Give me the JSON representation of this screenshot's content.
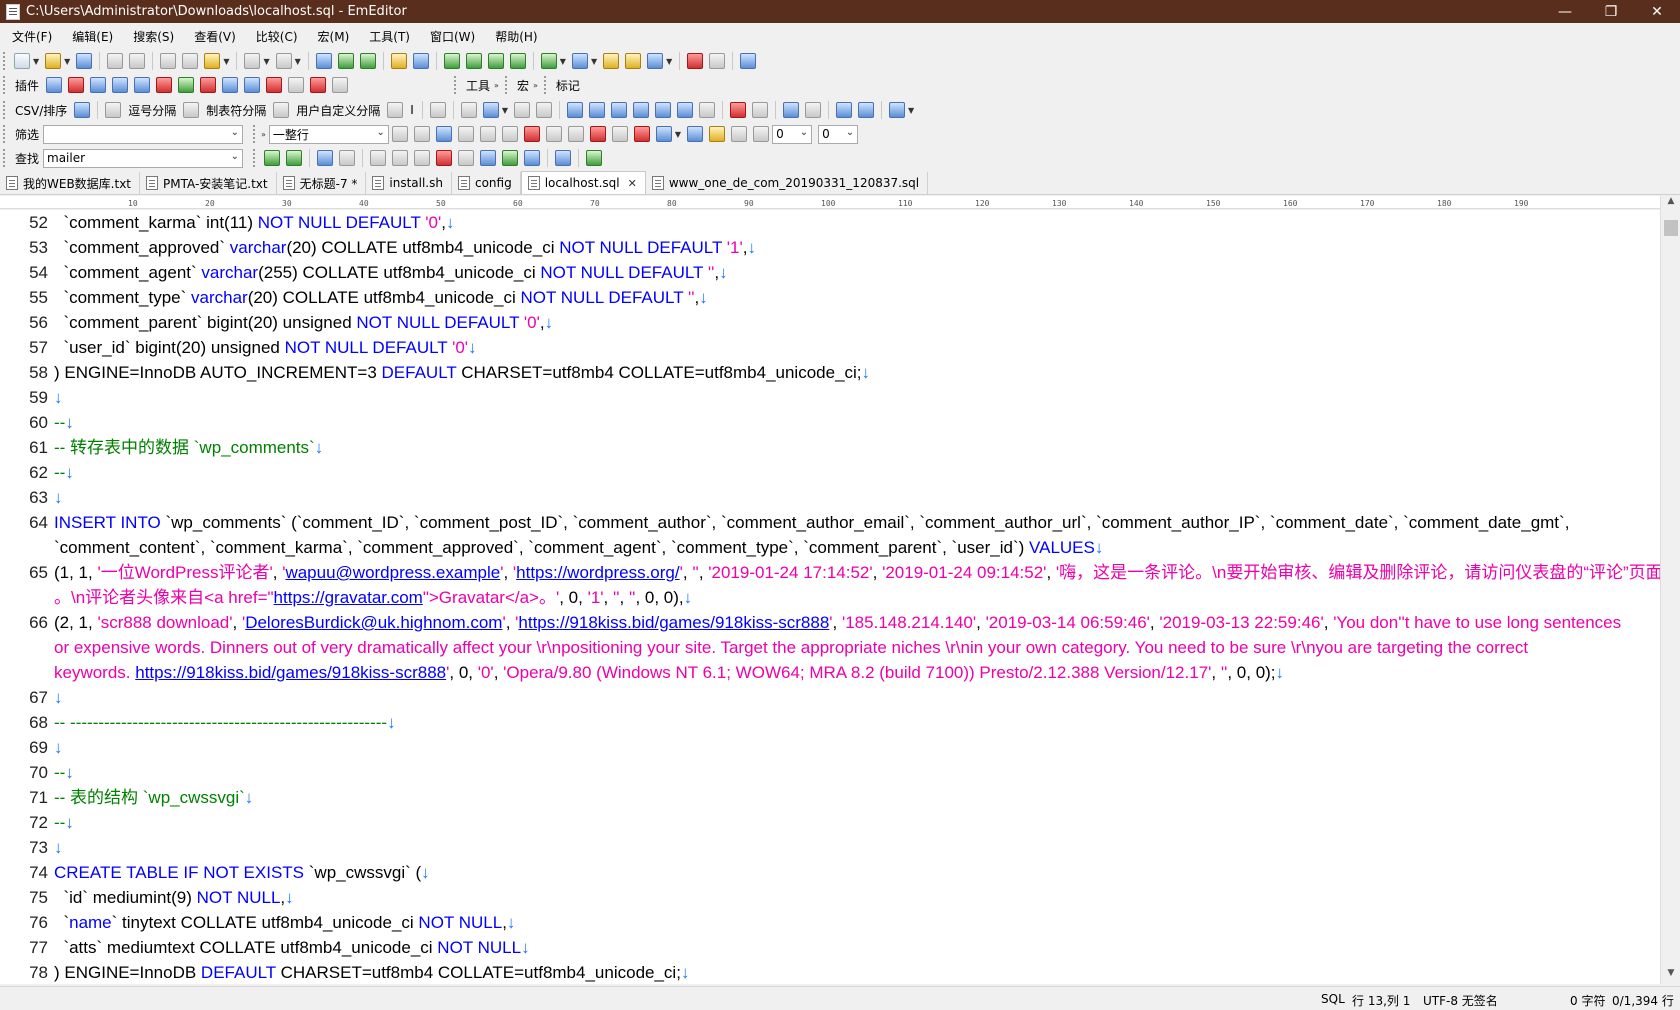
{
  "window": {
    "title": "C:\\Users\\Administrator\\Downloads\\localhost.sql - EmEditor",
    "minimize": "—",
    "maximize": "❐",
    "close": "✕"
  },
  "menu": [
    "文件(F)",
    "编辑(E)",
    "搜索(S)",
    "查看(V)",
    "比较(C)",
    "宏(M)",
    "工具(T)",
    "窗口(W)",
    "帮助(H)"
  ],
  "toolbar2": {
    "plugins_label": "插件",
    "tools_label": "工具",
    "macro_label": "宏",
    "marker_label": "标记"
  },
  "toolbar3": {
    "csv_label": "CSV/排序",
    "comma_label": "逗号分隔",
    "tab_label": "制表符分隔",
    "custom_label": "用户自定义分隔",
    "i_label": "I"
  },
  "filterbar": {
    "label": "筛选",
    "value": "",
    "mode": "一整行",
    "num1": "0",
    "num2": "0"
  },
  "findbar": {
    "label": "查找",
    "value": "mailer"
  },
  "tabs": [
    {
      "label": "我的WEB数据库.txt"
    },
    {
      "label": "PMTA-安装笔记.txt"
    },
    {
      "label": "无标题-7 *"
    },
    {
      "label": "install.sh"
    },
    {
      "label": "config"
    },
    {
      "label": "localhost.sql",
      "active": true,
      "close": "✕"
    },
    {
      "label": "www_one_de_com_20190331_120837.sql"
    }
  ],
  "ruler": [
    "10",
    "20",
    "30",
    "40",
    "50",
    "60",
    "70",
    "80",
    "90",
    "100",
    "110",
    "120",
    "130",
    "140",
    "150",
    "160",
    "170",
    "180",
    "190"
  ],
  "editor": {
    "lines": [
      {
        "n": "52",
        "segs": [
          [
            "",
            "  `comment_karma` int(11) "
          ],
          [
            "kw",
            "NOT NULL DEFAULT "
          ],
          [
            "str",
            "'0'"
          ],
          [
            "",
            ","
          ]
        ]
      },
      {
        "n": "53",
        "segs": [
          [
            "",
            "  `comment_approved` "
          ],
          [
            "kw",
            "varchar"
          ],
          [
            "",
            "(20) COLLATE utf8mb4_unicode_ci "
          ],
          [
            "kw",
            "NOT NULL DEFAULT "
          ],
          [
            "str",
            "'1'"
          ],
          [
            "",
            ","
          ]
        ]
      },
      {
        "n": "54",
        "segs": [
          [
            "",
            "  `comment_agent` "
          ],
          [
            "kw",
            "varchar"
          ],
          [
            "",
            "(255) COLLATE utf8mb4_unicode_ci "
          ],
          [
            "kw",
            "NOT NULL DEFAULT "
          ],
          [
            "str",
            "''"
          ],
          [
            "",
            ","
          ]
        ]
      },
      {
        "n": "55",
        "segs": [
          [
            "",
            "  `comment_type` "
          ],
          [
            "kw",
            "varchar"
          ],
          [
            "",
            "(20) COLLATE utf8mb4_unicode_ci "
          ],
          [
            "kw",
            "NOT NULL DEFAULT "
          ],
          [
            "str",
            "''"
          ],
          [
            "",
            ","
          ]
        ]
      },
      {
        "n": "56",
        "segs": [
          [
            "",
            "  `comment_parent` bigint(20) unsigned "
          ],
          [
            "kw",
            "NOT NULL DEFAULT "
          ],
          [
            "str",
            "'0'"
          ],
          [
            "",
            ","
          ]
        ]
      },
      {
        "n": "57",
        "segs": [
          [
            "",
            "  `user_id` bigint(20) unsigned "
          ],
          [
            "kw",
            "NOT NULL DEFAULT "
          ],
          [
            "str",
            "'0'"
          ]
        ]
      },
      {
        "n": "58",
        "segs": [
          [
            "",
            ") ENGINE=InnoDB AUTO_INCREMENT=3 "
          ],
          [
            "kw",
            "DEFAULT"
          ],
          [
            "",
            " CHARSET=utf8mb4 COLLATE=utf8mb4_unicode_ci;"
          ]
        ]
      },
      {
        "n": "59",
        "segs": []
      },
      {
        "n": "60",
        "segs": [
          [
            "cm",
            "--"
          ]
        ]
      },
      {
        "n": "61",
        "segs": [
          [
            "cm",
            "-- 转存表中的数据 `wp_comments`"
          ]
        ]
      },
      {
        "n": "62",
        "segs": [
          [
            "cm",
            "--"
          ]
        ]
      },
      {
        "n": "63",
        "segs": []
      },
      {
        "n": "64",
        "segs": [
          [
            "kw",
            "INSERT INTO"
          ],
          [
            "",
            " `wp_comments` (`comment_ID`, `comment_post_ID`, `comment_author`, `comment_author_email`, `comment_author_url`, `comment_author_IP`, `comment_date`, `comment_date_gmt`,"
          ]
        ],
        "noeol": true
      },
      {
        "n": "",
        "segs": [
          [
            "",
            "`comment_content`, `comment_karma`, `comment_approved`, `comment_agent`, `comment_type`, `comment_parent`, `user_id`) "
          ],
          [
            "kw",
            "VALUES"
          ]
        ]
      },
      {
        "n": "65",
        "segs": [
          [
            "",
            "(1, 1, "
          ],
          [
            "str",
            "'一位WordPress评论者'"
          ],
          [
            "",
            ", "
          ],
          [
            "str",
            "'"
          ],
          [
            "lk",
            "wapuu@wordpress.example"
          ],
          [
            "str",
            "'"
          ],
          [
            "",
            ", "
          ],
          [
            "str",
            "'"
          ],
          [
            "lk",
            "https://wordpress.org/"
          ],
          [
            "str",
            "'"
          ],
          [
            "",
            ", "
          ],
          [
            "str",
            "''"
          ],
          [
            "",
            ", "
          ],
          [
            "str",
            "'2019-01-24 17:14:52'"
          ],
          [
            "",
            ", "
          ],
          [
            "str",
            "'2019-01-24 09:14:52'"
          ],
          [
            "",
            ", "
          ],
          [
            "str",
            "'嗨，这是一条评论。\\n要开始审核、编辑及删除评论，请访问仪表盘的“评论”页面"
          ]
        ],
        "noeol": true
      },
      {
        "n": "",
        "segs": [
          [
            "str",
            "。\\n评论者头像来自<a href=\""
          ],
          [
            "lk",
            "https://gravatar.com"
          ],
          [
            "str",
            "\">Gravatar</a>。'"
          ],
          [
            "",
            ", 0, "
          ],
          [
            "str",
            "'1'"
          ],
          [
            "",
            ", "
          ],
          [
            "str",
            "''"
          ],
          [
            "",
            ", "
          ],
          [
            "str",
            "''"
          ],
          [
            "",
            ", 0, 0),"
          ]
        ]
      },
      {
        "n": "66",
        "segs": [
          [
            "",
            "(2, 1, "
          ],
          [
            "str",
            "'scr888 download'"
          ],
          [
            "",
            ", "
          ],
          [
            "str",
            "'"
          ],
          [
            "lk",
            "DeloresBurdick@uk.highnom.com"
          ],
          [
            "str",
            "'"
          ],
          [
            "",
            ", "
          ],
          [
            "str",
            "'"
          ],
          [
            "lk",
            "https://918kiss.bid/games/918kiss-scr888"
          ],
          [
            "str",
            "'"
          ],
          [
            "",
            ", "
          ],
          [
            "str",
            "'185.148.214.140'"
          ],
          [
            "",
            ", "
          ],
          [
            "str",
            "'2019-03-14 06:59:46'"
          ],
          [
            "",
            ", "
          ],
          [
            "str",
            "'2019-03-13 22:59:46'"
          ],
          [
            "",
            ", "
          ],
          [
            "str",
            "'You don''t have to use long sentences"
          ]
        ],
        "noeol": true
      },
      {
        "n": "",
        "segs": [
          [
            "str",
            "or expensive words. Dinners out of very dramatically affect your \\r\\npositioning your site. Target the appropriate niches \\r\\nin your own category. You need to be sure \\r\\nyou are targeting the correct"
          ]
        ],
        "noeol": true
      },
      {
        "n": "",
        "segs": [
          [
            "str",
            "keywords. "
          ],
          [
            "lk",
            "https://918kiss.bid/games/918kiss-scr888"
          ],
          [
            "str",
            "'"
          ],
          [
            "",
            ", 0, "
          ],
          [
            "str",
            "'0'"
          ],
          [
            "",
            ", "
          ],
          [
            "str",
            "'Opera/9.80 (Windows NT 6.1; WOW64; MRA 8.2 (build 7100)) Presto/2.12.388 Version/12.17'"
          ],
          [
            "",
            ", "
          ],
          [
            "str",
            "''"
          ],
          [
            "",
            ", 0, 0);"
          ]
        ]
      },
      {
        "n": "67",
        "segs": []
      },
      {
        "n": "68",
        "segs": [
          [
            "cm",
            "-- --------------------------------------------------------"
          ]
        ]
      },
      {
        "n": "69",
        "segs": []
      },
      {
        "n": "70",
        "segs": [
          [
            "cm",
            "--"
          ]
        ]
      },
      {
        "n": "71",
        "segs": [
          [
            "cm",
            "-- 表的结构 `wp_cwssvgi`"
          ]
        ]
      },
      {
        "n": "72",
        "segs": [
          [
            "cm",
            "--"
          ]
        ]
      },
      {
        "n": "73",
        "segs": []
      },
      {
        "n": "74",
        "segs": [
          [
            "kw",
            "CREATE TABLE IF NOT EXISTS"
          ],
          [
            "",
            " `wp_cwssvgi` ("
          ]
        ]
      },
      {
        "n": "75",
        "segs": [
          [
            "",
            "  `id` mediumint(9) "
          ],
          [
            "kw",
            "NOT NULL"
          ],
          [
            "",
            ","
          ]
        ]
      },
      {
        "n": "76",
        "segs": [
          [
            "",
            "  `"
          ],
          [
            "kw",
            "name"
          ],
          [
            "",
            "` tinytext COLLATE utf8mb4_unicode_ci "
          ],
          [
            "kw",
            "NOT NULL"
          ],
          [
            "",
            ","
          ]
        ]
      },
      {
        "n": "77",
        "segs": [
          [
            "",
            "  `atts` mediumtext COLLATE utf8mb4_unicode_ci "
          ],
          [
            "kw",
            "NOT NULL"
          ]
        ]
      },
      {
        "n": "78",
        "segs": [
          [
            "",
            ") ENGINE=InnoDB "
          ],
          [
            "kw",
            "DEFAULT"
          ],
          [
            "",
            " CHARSET=utf8mb4 COLLATE=utf8mb4_unicode_ci;"
          ]
        ]
      }
    ],
    "eol_mark": "↓"
  },
  "status": {
    "lang": "SQL",
    "position": "行 13,列 1",
    "encoding": "UTF-8 无签名",
    "chars": "0 字符",
    "lines": "0/1,394 行"
  }
}
